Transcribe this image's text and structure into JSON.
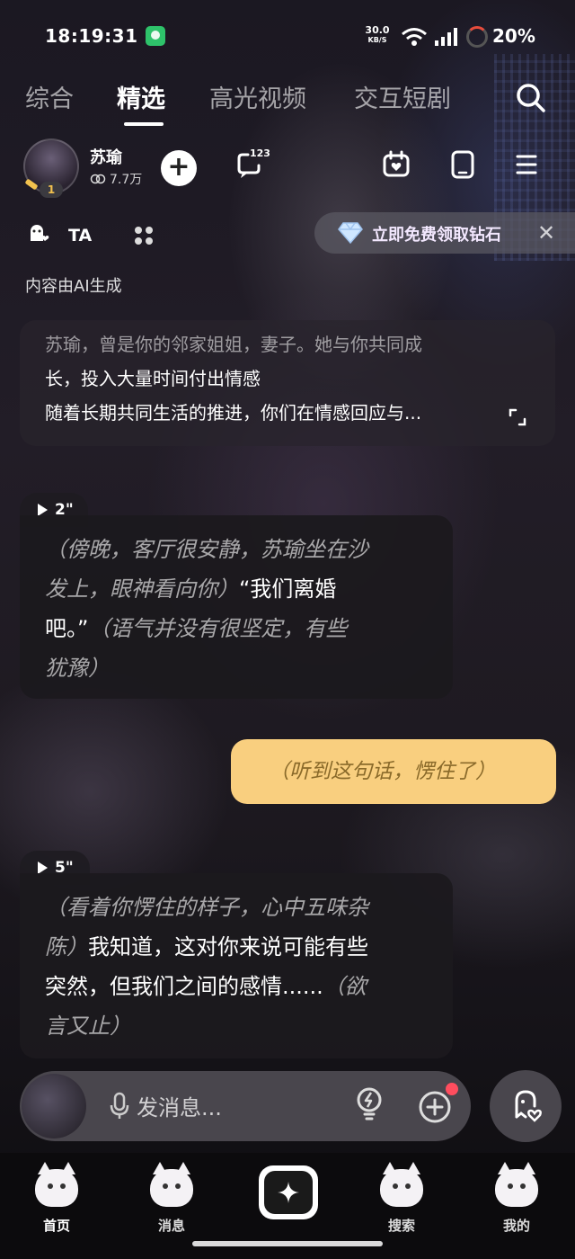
{
  "status_bar": {
    "time": "18:19:31",
    "net_speed": "30.0",
    "net_unit": "KB/S",
    "battery": "20%"
  },
  "tabs": [
    {
      "label": "综合",
      "active": false
    },
    {
      "label": "精选",
      "active": true
    },
    {
      "label": "高光视频",
      "active": false
    },
    {
      "label": "交互短剧",
      "active": false
    }
  ],
  "character": {
    "name": "苏瑜",
    "followers": "7.7万",
    "level": "1",
    "comment_count": "123",
    "ta_label": "TA"
  },
  "promo": {
    "text": "立即免费领取钻石"
  },
  "ai_note": "内容由AI生成",
  "intro": {
    "line1": "苏瑜，曾是你的邻家姐姐，妻子。她与你共同成",
    "line2": "长，投入大量时间付出情感",
    "line3": "随着长期共同生活的推进，你们在情感回应与..."
  },
  "messages": [
    {
      "duration": "2\"",
      "action1": "（傍晚，客厅很安静，苏瑜坐在沙",
      "action2": "发上，眼神看向你）",
      "speech2": "“我们离婚",
      "speech3": "吧。”",
      "action3": "（语气并没有很坚定，有些",
      "action4": "犹豫）"
    },
    {
      "user_text": "（听到这句话，愣住了）"
    },
    {
      "duration": "5\"",
      "action1": "（看着你愣住的样子，心中五味杂",
      "action2": "陈）",
      "speech2": "我知道，这对你来说可能有些",
      "speech3": "突然，但我们之间的感情......",
      "action3": "（欲",
      "action4": "言又止）"
    }
  ],
  "input": {
    "placeholder": "发消息..."
  },
  "nav": [
    {
      "label": "首页",
      "active": true
    },
    {
      "label": "消息",
      "active": false
    },
    {
      "label": "",
      "active": false
    },
    {
      "label": "搜索",
      "active": false
    },
    {
      "label": "我的",
      "active": false
    }
  ],
  "colors": {
    "user_bubble": "#f9cf7f",
    "user_bubble_text": "#8a6a2a",
    "notification_dot": "#ff4d5e",
    "battery_ring": "#e74c3c"
  }
}
